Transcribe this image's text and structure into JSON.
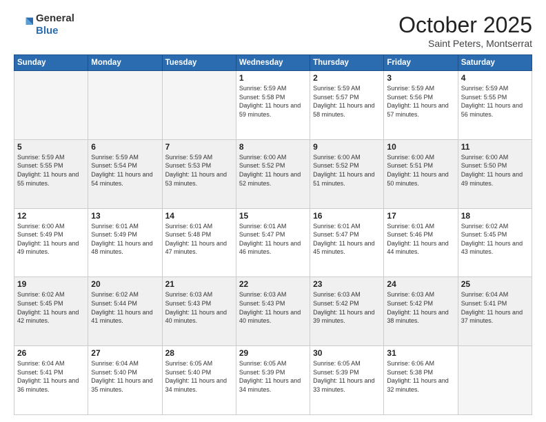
{
  "header": {
    "logo_general": "General",
    "logo_blue": "Blue",
    "month": "October 2025",
    "location": "Saint Peters, Montserrat"
  },
  "weekdays": [
    "Sunday",
    "Monday",
    "Tuesday",
    "Wednesday",
    "Thursday",
    "Friday",
    "Saturday"
  ],
  "weeks": [
    [
      {
        "day": "",
        "empty": true
      },
      {
        "day": "",
        "empty": true
      },
      {
        "day": "",
        "empty": true
      },
      {
        "day": "1",
        "sunrise": "Sunrise: 5:59 AM",
        "sunset": "Sunset: 5:58 PM",
        "daylight": "Daylight: 11 hours and 59 minutes."
      },
      {
        "day": "2",
        "sunrise": "Sunrise: 5:59 AM",
        "sunset": "Sunset: 5:57 PM",
        "daylight": "Daylight: 11 hours and 58 minutes."
      },
      {
        "day": "3",
        "sunrise": "Sunrise: 5:59 AM",
        "sunset": "Sunset: 5:56 PM",
        "daylight": "Daylight: 11 hours and 57 minutes."
      },
      {
        "day": "4",
        "sunrise": "Sunrise: 5:59 AM",
        "sunset": "Sunset: 5:55 PM",
        "daylight": "Daylight: 11 hours and 56 minutes."
      }
    ],
    [
      {
        "day": "5",
        "sunrise": "Sunrise: 5:59 AM",
        "sunset": "Sunset: 5:55 PM",
        "daylight": "Daylight: 11 hours and 55 minutes."
      },
      {
        "day": "6",
        "sunrise": "Sunrise: 5:59 AM",
        "sunset": "Sunset: 5:54 PM",
        "daylight": "Daylight: 11 hours and 54 minutes."
      },
      {
        "day": "7",
        "sunrise": "Sunrise: 5:59 AM",
        "sunset": "Sunset: 5:53 PM",
        "daylight": "Daylight: 11 hours and 53 minutes."
      },
      {
        "day": "8",
        "sunrise": "Sunrise: 6:00 AM",
        "sunset": "Sunset: 5:52 PM",
        "daylight": "Daylight: 11 hours and 52 minutes."
      },
      {
        "day": "9",
        "sunrise": "Sunrise: 6:00 AM",
        "sunset": "Sunset: 5:52 PM",
        "daylight": "Daylight: 11 hours and 51 minutes."
      },
      {
        "day": "10",
        "sunrise": "Sunrise: 6:00 AM",
        "sunset": "Sunset: 5:51 PM",
        "daylight": "Daylight: 11 hours and 50 minutes."
      },
      {
        "day": "11",
        "sunrise": "Sunrise: 6:00 AM",
        "sunset": "Sunset: 5:50 PM",
        "daylight": "Daylight: 11 hours and 49 minutes."
      }
    ],
    [
      {
        "day": "12",
        "sunrise": "Sunrise: 6:00 AM",
        "sunset": "Sunset: 5:49 PM",
        "daylight": "Daylight: 11 hours and 49 minutes."
      },
      {
        "day": "13",
        "sunrise": "Sunrise: 6:01 AM",
        "sunset": "Sunset: 5:49 PM",
        "daylight": "Daylight: 11 hours and 48 minutes."
      },
      {
        "day": "14",
        "sunrise": "Sunrise: 6:01 AM",
        "sunset": "Sunset: 5:48 PM",
        "daylight": "Daylight: 11 hours and 47 minutes."
      },
      {
        "day": "15",
        "sunrise": "Sunrise: 6:01 AM",
        "sunset": "Sunset: 5:47 PM",
        "daylight": "Daylight: 11 hours and 46 minutes."
      },
      {
        "day": "16",
        "sunrise": "Sunrise: 6:01 AM",
        "sunset": "Sunset: 5:47 PM",
        "daylight": "Daylight: 11 hours and 45 minutes."
      },
      {
        "day": "17",
        "sunrise": "Sunrise: 6:01 AM",
        "sunset": "Sunset: 5:46 PM",
        "daylight": "Daylight: 11 hours and 44 minutes."
      },
      {
        "day": "18",
        "sunrise": "Sunrise: 6:02 AM",
        "sunset": "Sunset: 5:45 PM",
        "daylight": "Daylight: 11 hours and 43 minutes."
      }
    ],
    [
      {
        "day": "19",
        "sunrise": "Sunrise: 6:02 AM",
        "sunset": "Sunset: 5:45 PM",
        "daylight": "Daylight: 11 hours and 42 minutes."
      },
      {
        "day": "20",
        "sunrise": "Sunrise: 6:02 AM",
        "sunset": "Sunset: 5:44 PM",
        "daylight": "Daylight: 11 hours and 41 minutes."
      },
      {
        "day": "21",
        "sunrise": "Sunrise: 6:03 AM",
        "sunset": "Sunset: 5:43 PM",
        "daylight": "Daylight: 11 hours and 40 minutes."
      },
      {
        "day": "22",
        "sunrise": "Sunrise: 6:03 AM",
        "sunset": "Sunset: 5:43 PM",
        "daylight": "Daylight: 11 hours and 40 minutes."
      },
      {
        "day": "23",
        "sunrise": "Sunrise: 6:03 AM",
        "sunset": "Sunset: 5:42 PM",
        "daylight": "Daylight: 11 hours and 39 minutes."
      },
      {
        "day": "24",
        "sunrise": "Sunrise: 6:03 AM",
        "sunset": "Sunset: 5:42 PM",
        "daylight": "Daylight: 11 hours and 38 minutes."
      },
      {
        "day": "25",
        "sunrise": "Sunrise: 6:04 AM",
        "sunset": "Sunset: 5:41 PM",
        "daylight": "Daylight: 11 hours and 37 minutes."
      }
    ],
    [
      {
        "day": "26",
        "sunrise": "Sunrise: 6:04 AM",
        "sunset": "Sunset: 5:41 PM",
        "daylight": "Daylight: 11 hours and 36 minutes."
      },
      {
        "day": "27",
        "sunrise": "Sunrise: 6:04 AM",
        "sunset": "Sunset: 5:40 PM",
        "daylight": "Daylight: 11 hours and 35 minutes."
      },
      {
        "day": "28",
        "sunrise": "Sunrise: 6:05 AM",
        "sunset": "Sunset: 5:40 PM",
        "daylight": "Daylight: 11 hours and 34 minutes."
      },
      {
        "day": "29",
        "sunrise": "Sunrise: 6:05 AM",
        "sunset": "Sunset: 5:39 PM",
        "daylight": "Daylight: 11 hours and 34 minutes."
      },
      {
        "day": "30",
        "sunrise": "Sunrise: 6:05 AM",
        "sunset": "Sunset: 5:39 PM",
        "daylight": "Daylight: 11 hours and 33 minutes."
      },
      {
        "day": "31",
        "sunrise": "Sunrise: 6:06 AM",
        "sunset": "Sunset: 5:38 PM",
        "daylight": "Daylight: 11 hours and 32 minutes."
      },
      {
        "day": "",
        "empty": true
      }
    ]
  ]
}
